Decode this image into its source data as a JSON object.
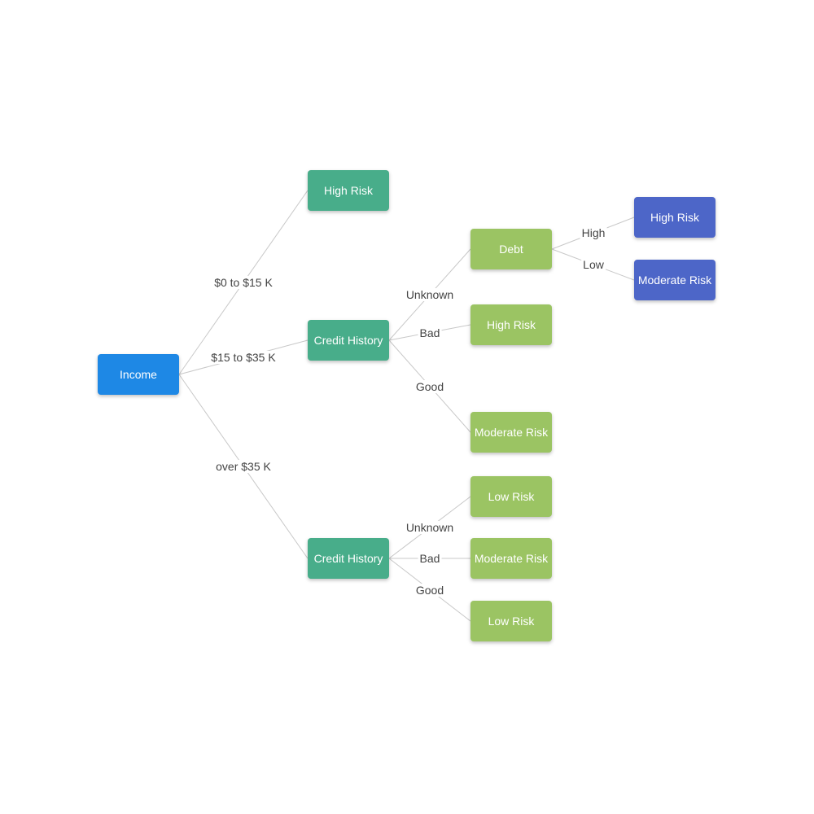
{
  "colors": {
    "root": "#1e88e5",
    "level1": "#48ad8a",
    "level2": "#9bc463",
    "level3": "#4d66c8",
    "edge": "#c8c8c8"
  },
  "nodes": [
    {
      "id": "income",
      "label": "Income",
      "level": "root"
    },
    {
      "id": "high-risk-1",
      "label": "High Risk",
      "level": "level1"
    },
    {
      "id": "credit-history-1",
      "label": "Credit History",
      "level": "level1"
    },
    {
      "id": "credit-history-2",
      "label": "Credit History",
      "level": "level1"
    },
    {
      "id": "debt",
      "label": "Debt",
      "level": "level2"
    },
    {
      "id": "high-risk-2",
      "label": "High Risk",
      "level": "level2"
    },
    {
      "id": "moderate-risk-1",
      "label": "Moderate Risk",
      "level": "level2"
    },
    {
      "id": "low-risk-1",
      "label": "Low Risk",
      "level": "level2"
    },
    {
      "id": "moderate-risk-2",
      "label": "Moderate Risk",
      "level": "level2"
    },
    {
      "id": "low-risk-2",
      "label": "Low Risk",
      "level": "level2"
    },
    {
      "id": "high-risk-3",
      "label": "High Risk",
      "level": "level3"
    },
    {
      "id": "moderate-risk-3",
      "label": "Moderate Risk",
      "level": "level3"
    }
  ],
  "edges": [
    {
      "from": "income",
      "to": "high-risk-1",
      "label": "$0 to $15 K"
    },
    {
      "from": "income",
      "to": "credit-history-1",
      "label": "$15 to $35 K"
    },
    {
      "from": "income",
      "to": "credit-history-2",
      "label": "over $35 K"
    },
    {
      "from": "credit-history-1",
      "to": "debt",
      "label": "Unknown"
    },
    {
      "from": "credit-history-1",
      "to": "high-risk-2",
      "label": "Bad"
    },
    {
      "from": "credit-history-1",
      "to": "moderate-risk-1",
      "label": "Good"
    },
    {
      "from": "credit-history-2",
      "to": "low-risk-1",
      "label": "Unknown"
    },
    {
      "from": "credit-history-2",
      "to": "moderate-risk-2",
      "label": "Bad"
    },
    {
      "from": "credit-history-2",
      "to": "low-risk-2",
      "label": "Good"
    },
    {
      "from": "debt",
      "to": "high-risk-3",
      "label": "High"
    },
    {
      "from": "debt",
      "to": "moderate-risk-3",
      "label": "Low"
    }
  ]
}
